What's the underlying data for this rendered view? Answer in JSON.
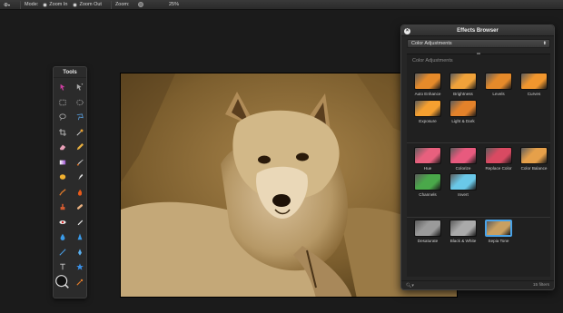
{
  "toolbar": {
    "mode_label": "Mode:",
    "zoom_in_label": "Zoom In",
    "zoom_out_label": "Zoom Out",
    "zoom_label": "Zoom:",
    "zoom_value": "25%"
  },
  "tools": {
    "title": "Tools"
  },
  "effects": {
    "title": "Effects Browser",
    "category_select": "Color Adjustments",
    "section_title": "Color Adjustments",
    "items": [
      {
        "label": "Auto Enhance",
        "color": "#e58a2a"
      },
      {
        "label": "Brightness",
        "color": "#f0a23a"
      },
      {
        "label": "Levels",
        "color": "#e58a2a"
      },
      {
        "label": "Curves",
        "color": "#f0962e"
      },
      {
        "label": "Exposure",
        "color": "#f5a030"
      },
      {
        "label": "Light & Dark",
        "color": "#e4822a"
      },
      {
        "label": "Hue",
        "color": "#e8607e"
      },
      {
        "label": "Colorize",
        "color": "#e85a7e"
      },
      {
        "label": "Replace Color",
        "color": "#d94a62"
      },
      {
        "label": "Color Balance",
        "color": "#e6a04a"
      },
      {
        "label": "Channels",
        "color": "#4aa84a"
      },
      {
        "label": "Invert",
        "color": "#6ac8e8"
      },
      {
        "label": "Desaturate",
        "color": "#9a9a9a"
      },
      {
        "label": "Black & White",
        "color": "#aaaaaa"
      },
      {
        "label": "Sepia Tone",
        "color": "#c8a062"
      }
    ],
    "footer_count": "15 filters",
    "accent": "#4aa3e8"
  }
}
